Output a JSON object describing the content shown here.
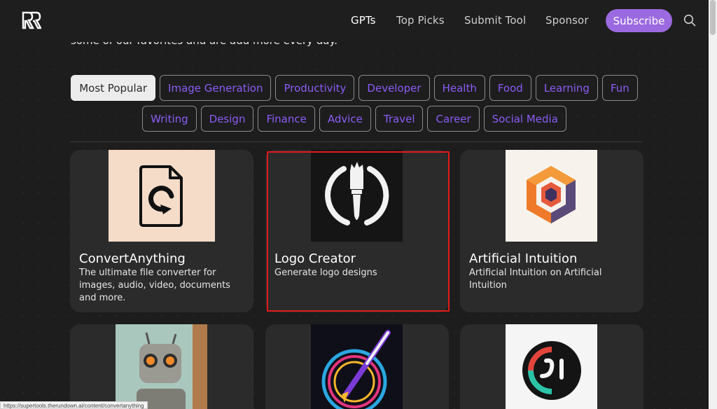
{
  "nav": {
    "links": [
      "GPTs",
      "Top Picks",
      "Submit Tool",
      "Sponsor"
    ],
    "subscribe_label": "Subscribe",
    "search_icon": "search-icon",
    "accent": "#9b6ae0"
  },
  "intro_text": "some of our favorites and are add more every day.",
  "categories": {
    "row1": [
      "Most Popular",
      "Image Generation",
      "Productivity",
      "Developer",
      "Health",
      "Food",
      "Learning",
      "Fun"
    ],
    "row2": [
      "Writing",
      "Design",
      "Finance",
      "Advice",
      "Travel",
      "Career",
      "Social Media"
    ],
    "active": "Most Popular",
    "chip_color": "#8b5cf6"
  },
  "cards": [
    {
      "title": "ConvertAnything",
      "description": "The ultimate file converter for images, audio, video, documents and more.",
      "icon": "file-convert-icon"
    },
    {
      "title": "Logo Creator",
      "description": "Generate logo designs",
      "icon": "paintbrush-logo-icon",
      "highlighted": true
    },
    {
      "title": "Artificial Intuition",
      "description": "Artificial Intuition on Artificial Intuition",
      "icon": "isometric-cube-icon"
    },
    {
      "title": "",
      "description": "",
      "icon": "robot-image"
    },
    {
      "title": "",
      "description": "",
      "icon": "neon-brush-image"
    },
    {
      "title": "",
      "description": "",
      "icon": "circle-logo-image"
    }
  ],
  "status_bar_url": "https://supertools.therundown.ai/content/convertanything"
}
